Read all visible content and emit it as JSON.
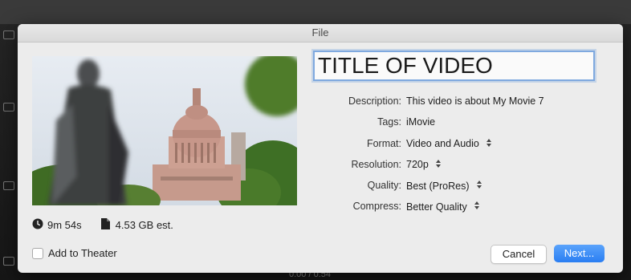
{
  "window": {
    "title": "File"
  },
  "video": {
    "title": "TITLE OF VIDEO",
    "duration": "9m 54s",
    "size": "4.53 GB est."
  },
  "form": {
    "rows": [
      {
        "label": "Description:",
        "value": "This video is about My Movie 7",
        "stepper": false
      },
      {
        "label": "Tags:",
        "value": "iMovie",
        "stepper": false
      },
      {
        "label": "Format:",
        "value": "Video and Audio",
        "stepper": true
      },
      {
        "label": "Resolution:",
        "value": "720p",
        "stepper": true
      },
      {
        "label": "Quality:",
        "value": "Best (ProRes)",
        "stepper": true
      },
      {
        "label": "Compress:",
        "value": "Better Quality",
        "stepper": true
      }
    ]
  },
  "options": {
    "add_to_theater": "Add to Theater",
    "add_to_theater_checked": false
  },
  "buttons": {
    "cancel": "Cancel",
    "next": "Next..."
  },
  "background": {
    "timecode": "0:00 / 0:54"
  },
  "colors": {
    "accent": "#2a7ef2",
    "focus_ring": "#7fa9df",
    "dialog_bg": "#ececec"
  },
  "icons": {
    "duration": "clock-icon",
    "size": "file-icon",
    "stepper": "up-down-arrows-icon"
  }
}
